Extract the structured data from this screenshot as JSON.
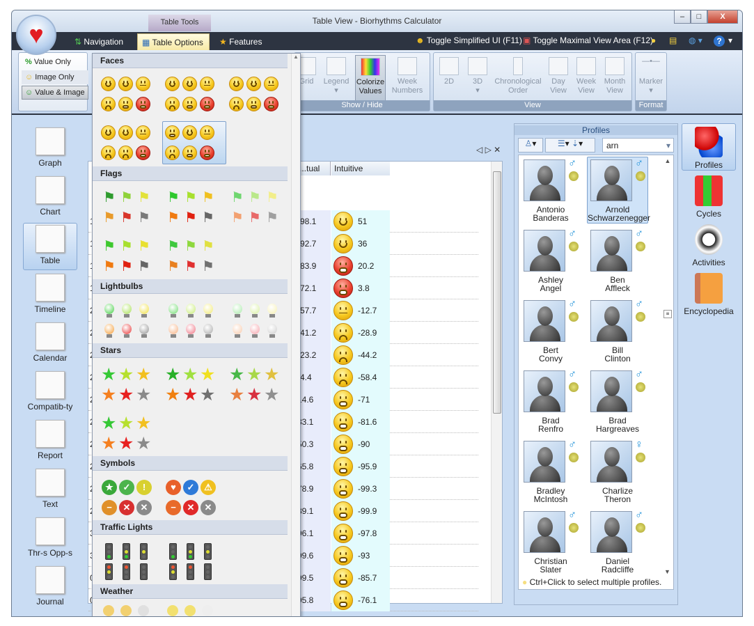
{
  "window": {
    "title": "Table View - Biorhythms Calculator",
    "context_tab": "Table Tools",
    "controls": [
      "–",
      "□",
      "X"
    ]
  },
  "app_icon": "heart-icon",
  "tabs": [
    {
      "label": "Navigation",
      "icon": "arrows-icon"
    },
    {
      "label": "Table Options",
      "icon": "table-icon",
      "active": true
    },
    {
      "label": "Features",
      "icon": "star-icon"
    }
  ],
  "right_tools": {
    "simplified": "Toggle Simplified UI (F11)",
    "maximal": "Toggle Maximal View Area (F12)",
    "help": "?"
  },
  "ribbon": {
    "value_options": [
      {
        "label": "Value Only",
        "icon": "percent-icon"
      },
      {
        "label": "Image Only",
        "icon": "face-icon"
      },
      {
        "label": "Value & Image",
        "icon": "face-percent-icon",
        "selected": true
      }
    ],
    "show_hide": {
      "label": "Show / Hide",
      "buttons": [
        "Grid",
        "Legend",
        "Colorize Values",
        "Week Numbers"
      ],
      "pressed": "Colorize Values"
    },
    "view": {
      "label": "View",
      "buttons": [
        "2D",
        "3D",
        "Chronological Order",
        "Day View",
        "Week View",
        "Month View"
      ]
    },
    "format": {
      "label": "Format",
      "buttons": [
        "Marker"
      ]
    }
  },
  "left_nav": [
    "Graph",
    "Chart",
    "Table",
    "Timeline",
    "Calendar",
    "Compatib-ty",
    "Report",
    "Text",
    "Thr-s Opp-s",
    "Journal"
  ],
  "left_nav_selected": "Table",
  "table": {
    "columns": [
      "...tual",
      "Intuitive"
    ],
    "nav": [
      "◁",
      "▷",
      "✕"
    ],
    "rows": [
      {
        "c0": "1",
        "actual": "-98.1",
        "intuitive": "51",
        "face": "happy",
        "color": "yellow"
      },
      {
        "c0": "1",
        "actual": "-92.7",
        "intuitive": "36",
        "face": "happy",
        "color": "yellow"
      },
      {
        "c0": "1",
        "actual": "-83.9",
        "intuitive": "20.2",
        "face": "worried",
        "color": "red"
      },
      {
        "c0": "1",
        "actual": "-72.1",
        "intuitive": "3.8",
        "face": "worried",
        "color": "red"
      },
      {
        "c0": "2",
        "actual": "-57.7",
        "intuitive": "-12.7",
        "face": "neutral",
        "color": "yellow"
      },
      {
        "c0": "2",
        "actual": "-41.2",
        "intuitive": "-28.9",
        "face": "sad",
        "color": "yellow"
      },
      {
        "c0": "2",
        "actual": "-23.2",
        "intuitive": "-44.2",
        "face": "sad",
        "color": "yellow"
      },
      {
        "c0": "2",
        "actual": "-4.4",
        "intuitive": "-58.4",
        "face": "sad",
        "color": "yellow"
      },
      {
        "c0": "2",
        "actual": "14.6",
        "intuitive": "-71",
        "face": "worried",
        "color": "yellow"
      },
      {
        "c0": "2",
        "actual": "33.1",
        "intuitive": "-81.6",
        "face": "worried",
        "color": "yellow"
      },
      {
        "c0": "2",
        "actual": "50.3",
        "intuitive": "-90",
        "face": "worried",
        "color": "yellow"
      },
      {
        "c0": "2",
        "actual": "65.8",
        "intuitive": "-95.9",
        "face": "worried",
        "color": "yellow"
      },
      {
        "c0": "2",
        "actual": "78.9",
        "intuitive": "-99.3",
        "face": "worried",
        "color": "yellow"
      },
      {
        "c0": "2",
        "actual": "89.1",
        "intuitive": "-99.9",
        "face": "worried",
        "color": "yellow"
      },
      {
        "c0": "3",
        "actual": "96.1",
        "intuitive": "-97.8",
        "face": "worried",
        "color": "yellow"
      },
      {
        "c0": "3",
        "actual": "99.6",
        "intuitive": "-93",
        "face": "worried",
        "color": "yellow"
      },
      {
        "c0": "0",
        "actual": "99.5",
        "intuitive": "-85.7",
        "face": "worried",
        "color": "yellow"
      },
      {
        "c0": "0",
        "actual": "95.8",
        "intuitive": "-76.1",
        "face": "worried",
        "color": "yellow"
      }
    ]
  },
  "icon_sets": [
    {
      "title": "Faces",
      "kind": "face",
      "selected_set": 4,
      "sets": [
        [
          [
            "happy",
            "smile",
            "neutral"
          ],
          [
            "sad",
            "worried",
            "red-angry"
          ]
        ],
        [
          [
            "happy",
            "smile",
            "neutral"
          ],
          [
            "sad",
            "worried",
            "red-worried"
          ]
        ],
        [
          [
            "happy",
            "smile",
            "neutral"
          ],
          [
            "sad",
            "worried",
            "red-worried"
          ]
        ],
        [
          [
            "happy",
            "smile",
            "neutral"
          ],
          [
            "sad",
            "sad",
            "red-angry"
          ]
        ],
        [
          [
            "worried",
            "smile",
            "neutral"
          ],
          [
            "sad",
            "worried",
            "red-worried"
          ]
        ]
      ]
    },
    {
      "title": "Flags",
      "kind": "flag",
      "sets": [
        [
          [
            "#2e9b2e",
            "#8fd23a",
            "#e2e23a"
          ],
          [
            "#e89a2a",
            "#d8342a",
            "#7a7a7a"
          ]
        ],
        [
          [
            "#2ec82e",
            "#a8e02e",
            "#f0c020"
          ],
          [
            "#f07a10",
            "#e02010",
            "#666666"
          ]
        ],
        [
          [
            "#6fd66f",
            "#b9e88a",
            "#f2ee8a"
          ],
          [
            "#f2a070",
            "#e86a6a",
            "#a0a0a0"
          ]
        ],
        [
          [
            "#3ec82e",
            "#a8e02e",
            "#e8e030"
          ],
          [
            "#f07a10",
            "#e02010",
            "#666666"
          ]
        ],
        [
          [
            "#3ec83e",
            "#8ed83e",
            "#e0e040"
          ],
          [
            "#e88020",
            "#e03030",
            "#707070"
          ]
        ]
      ]
    },
    {
      "title": "Lightbulbs",
      "kind": "bulb",
      "sets": [
        [
          [
            "#3fcf3f",
            "#a6e050",
            "#f0e040"
          ],
          [
            "#f59a30",
            "#e83030",
            "#909090"
          ]
        ],
        [
          [
            "#6fdc6f",
            "#c6ec70",
            "#f2ea70"
          ],
          [
            "#f7b080",
            "#f07080",
            "#a8a8a8"
          ]
        ],
        [
          [
            "#a8eaa8",
            "#d8f0a0",
            "#f6f0b0"
          ],
          [
            "#f8c8a8",
            "#f5a0a8",
            "#cccccc"
          ]
        ]
      ]
    },
    {
      "title": "Stars",
      "kind": "star",
      "sets": [
        [
          [
            "#36c836",
            "#b6e02e",
            "#f2c020"
          ],
          [
            "#f58020",
            "#e82020",
            "#8a8a8a"
          ]
        ],
        [
          [
            "#28b028",
            "#a0e040",
            "#f0e020"
          ],
          [
            "#f08010",
            "#e02020",
            "#707070"
          ]
        ],
        [
          [
            "#48b848",
            "#a8d848",
            "#e0c040"
          ],
          [
            "#e88040",
            "#d83040",
            "#909090"
          ]
        ],
        [
          [
            "#36c836",
            "#b6e02e",
            "#f2c020"
          ],
          [
            "#f58020",
            "#e82020",
            "#8a8a8a"
          ]
        ]
      ]
    },
    {
      "title": "Symbols",
      "kind": "symbol",
      "sets": [
        [
          [
            [
              "#3aa83a",
              "★"
            ],
            [
              "#4cb44c",
              "✓"
            ],
            [
              "#d8d030",
              "!"
            ]
          ],
          [
            [
              "#e0902a",
              "−"
            ],
            [
              "#d83030",
              "✕"
            ],
            [
              "#8a8a8a",
              "✕"
            ]
          ]
        ],
        [
          [
            [
              "#e8602a",
              "♥"
            ],
            [
              "#2e7ad8",
              "✓"
            ],
            [
              "#f0c020",
              "⚠"
            ]
          ],
          [
            [
              "#e86a2a",
              "−"
            ],
            [
              "#e02828",
              "✕"
            ],
            [
              "#8a8a8a",
              "✕"
            ]
          ]
        ]
      ]
    },
    {
      "title": "Traffic  Lights",
      "kind": "traffic",
      "sets": [
        [
          [
            "green",
            "yellow-green",
            "yellow"
          ],
          [
            "red-yellow",
            "red",
            "off"
          ]
        ],
        [
          [
            "green",
            "yellow-green",
            "yellow"
          ],
          [
            "red-yellow",
            "red",
            "off"
          ]
        ]
      ]
    },
    {
      "title": "Weather",
      "kind": "weather",
      "sets": [
        [
          [
            "#f2d070",
            "#f2d070",
            "#e0e0e0"
          ],
          [
            "",
            "",
            ""
          ]
        ],
        [
          [
            "#f2e070",
            "#f2e070",
            "#eeeeee"
          ],
          [
            "",
            "",
            ""
          ]
        ]
      ]
    }
  ],
  "profiles": {
    "title": "Profiles",
    "search": "arn",
    "items": [
      {
        "first": "Antonio",
        "last": "Banderas",
        "gender": "♂"
      },
      {
        "first": "Arnold",
        "last": "Schwarzenegger",
        "gender": "♂",
        "selected": true
      },
      {
        "first": "Ashley",
        "last": "Angel",
        "gender": "♂"
      },
      {
        "first": "Ben",
        "last": "Affleck",
        "gender": "♂"
      },
      {
        "first": "Bert",
        "last": "Convy",
        "gender": "♂"
      },
      {
        "first": "Bill",
        "last": "Clinton",
        "gender": "♂"
      },
      {
        "first": "Brad",
        "last": "Renfro",
        "gender": "♂"
      },
      {
        "first": "Brad",
        "last": "Hargreaves",
        "gender": "♂"
      },
      {
        "first": "Bradley",
        "last": "McIntosh",
        "gender": "♂"
      },
      {
        "first": "Charlize",
        "last": "Theron",
        "gender": "♀"
      },
      {
        "first": "Christian",
        "last": "Slater",
        "gender": "♂"
      },
      {
        "first": "Daniel",
        "last": "Radcliffe",
        "gender": "♂"
      },
      {
        "first": "",
        "last": "",
        "gender": "♂"
      },
      {
        "first": "",
        "last": "",
        "gender": "♂"
      }
    ],
    "hint": "Ctrl+Click to select multiple profiles."
  },
  "right_nav": [
    "Profiles",
    "Cycles",
    "Activities",
    "Encyclopedia"
  ],
  "right_nav_selected": "Profiles"
}
